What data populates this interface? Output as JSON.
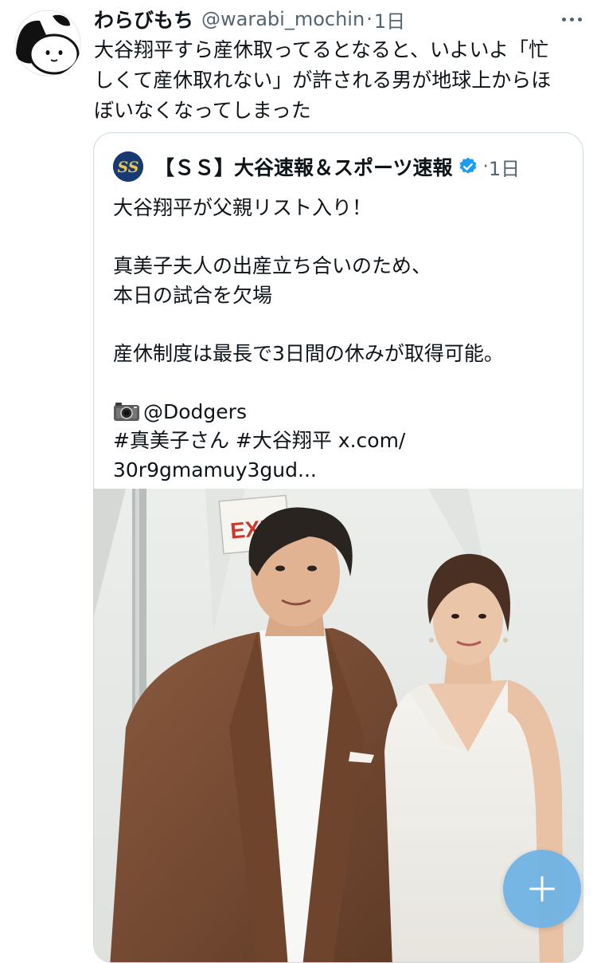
{
  "tweet": {
    "display_name": "わらびもち",
    "handle": "@warabi_mochin",
    "separator": "·",
    "time": "1日",
    "text_lines": [
      "大谷翔平すら産休取ってるとなると、いよいよ「忙",
      "しくて産休取れない」が許される男が地球上からほ",
      "ぼいなくなってしまった"
    ]
  },
  "quote": {
    "display_name": "【ＳＳ】大谷速報＆スポーツ速報",
    "separator": "·",
    "time": "1日",
    "avatar_text": "SS",
    "lines": [
      "大谷翔平が父親リスト入り！",
      "",
      "真美子夫人の出産立ち合いのため、",
      "本日の試合を欠場",
      "",
      "産休制度は最長で3日間の休みが取得可能。",
      ""
    ],
    "credit": "@Dodgers",
    "hashtags": "#真美子さん #大谷翔平 x.com/",
    "link_cont": "30r9gmamuy3gud...",
    "photo_sign": "EXIT"
  },
  "icons": {
    "more": "more-dots-icon",
    "verified": "verified-badge-icon",
    "camera": "camera-emoji-icon",
    "compose": "plus-icon"
  },
  "colors": {
    "text": "#0f1419",
    "muted": "#536471",
    "verified": "#1d9bf0",
    "fab": "#6cb2e6",
    "border": "#cfd9de"
  }
}
